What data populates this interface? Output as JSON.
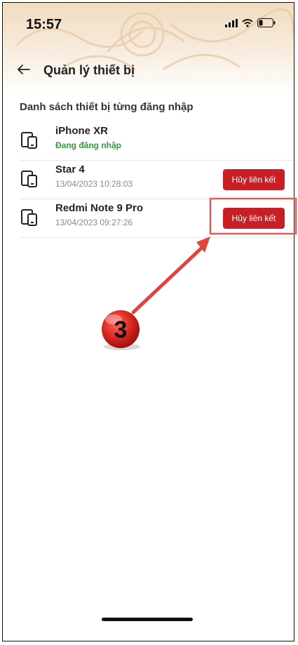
{
  "status_bar": {
    "time": "15:57"
  },
  "header": {
    "title": "Quản lý thiết bị",
    "back_icon": "arrow-left-icon"
  },
  "section": {
    "title": "Danh sách thiết bị từng đăng nhập"
  },
  "devices": [
    {
      "name": "iPhone XR",
      "status": "Đang đăng nhập",
      "icon": "devices-icon"
    },
    {
      "name": "Star 4",
      "date": "13/04/2023 10:28:03",
      "action": "Hủy liên kết",
      "icon": "devices-icon"
    },
    {
      "name": "Redmi Note 9 Pro",
      "date": "13/04/2023 09:27:26",
      "action": "Hủy liên kết",
      "icon": "devices-icon"
    }
  ],
  "annotation": {
    "step": "3"
  },
  "colors": {
    "accent_red": "#c81f26",
    "active_green": "#2e9e3c",
    "header_beige": "#f0dcc1",
    "highlight_box": "#e05a5a"
  }
}
